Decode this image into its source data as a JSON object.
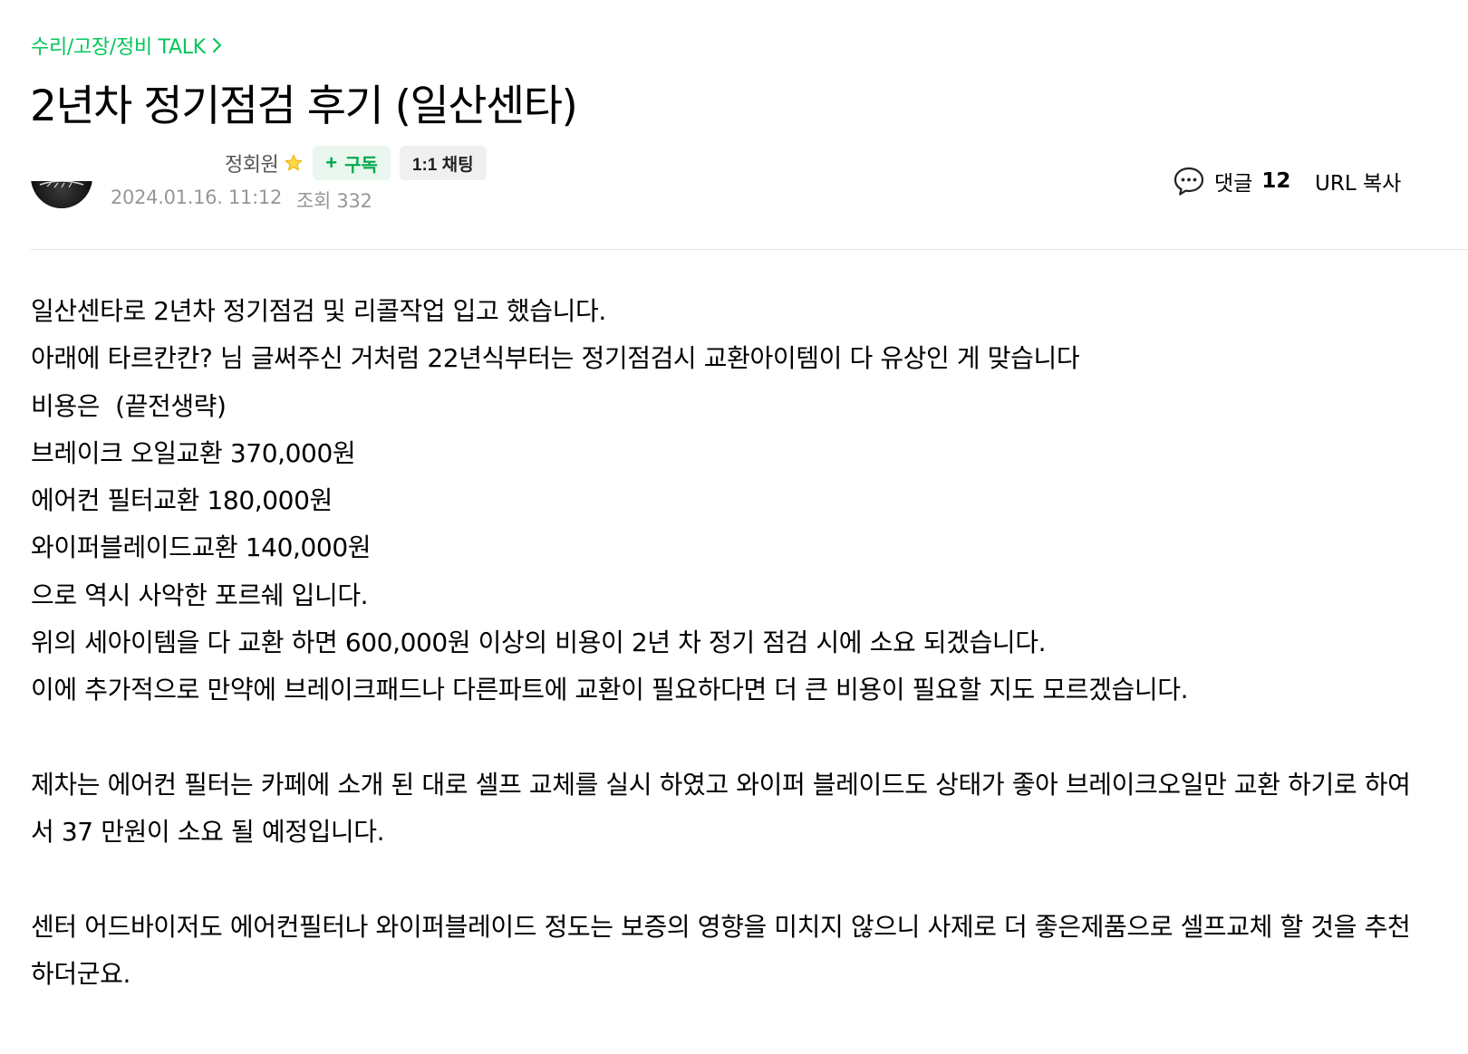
{
  "board": {
    "name": "수리/고장/정비 TALK"
  },
  "post": {
    "title": "2년차 정기점검 후기 (일산센타)",
    "author": "정회원",
    "date": "2024.01.16. 11:12",
    "views": "조회 332"
  },
  "actions": {
    "subscribe_label": "구독",
    "chat_label": "1:1 채팅",
    "comment_label": "댓글",
    "comment_count": "12",
    "url_copy_label": "URL 복사"
  },
  "content": {
    "lines": [
      "일산센타로 2년차 정기점검 및 리콜작업 입고 했습니다.",
      "아래에 타르칸칸? 님 글써주신 거처럼 22년식부터는 정기점검시 교환아이템이 다 유상인 게 맞습니다",
      "비용은  (끝전생략)",
      "브레이크 오일교환 370,000원",
      "에어컨 필터교환 180,000원",
      "와이퍼블레이드교환 140,000원",
      "으로 역시 사악한 포르쉐 입니다.",
      "위의 세아이템을 다 교환 하면 600,000원 이상의 비용이 2년 차 정기 점검 시에 소요 되겠습니다.",
      "이에 추가적으로 만약에 브레이크패드나 다른파트에 교환이 필요하다면 더 큰 비용이 필요할 지도 모르겠습니다."
    ],
    "paragraph2": "제차는 에어컨 필터는 카페에 소개 된 대로 셀프 교체를 실시 하였고 와이퍼 블레이드도 상태가 좋아 브레이크오일만 교환 하기로 하여서 37 만원이 소요 될 예정입니다.",
    "paragraph3": "센터 어드바이저도 에어컨필터나 와이퍼블레이드 정도는 보증의 영향을 미치지 않으니 사제로 더 좋은제품으로 셀프교체 할 것을 추천 하더군요."
  },
  "colors": {
    "accent_green": "#03c75a",
    "meta_gray": "#979797",
    "subscribe_bg": "#eaf7ee",
    "chat_bg": "#f0f0f0"
  },
  "icons": {
    "board_chevron": "chevron-right-icon",
    "author_grade": "star-icon",
    "comment": "speech-bubble-icon",
    "subscribe_plus": "plus-icon"
  }
}
